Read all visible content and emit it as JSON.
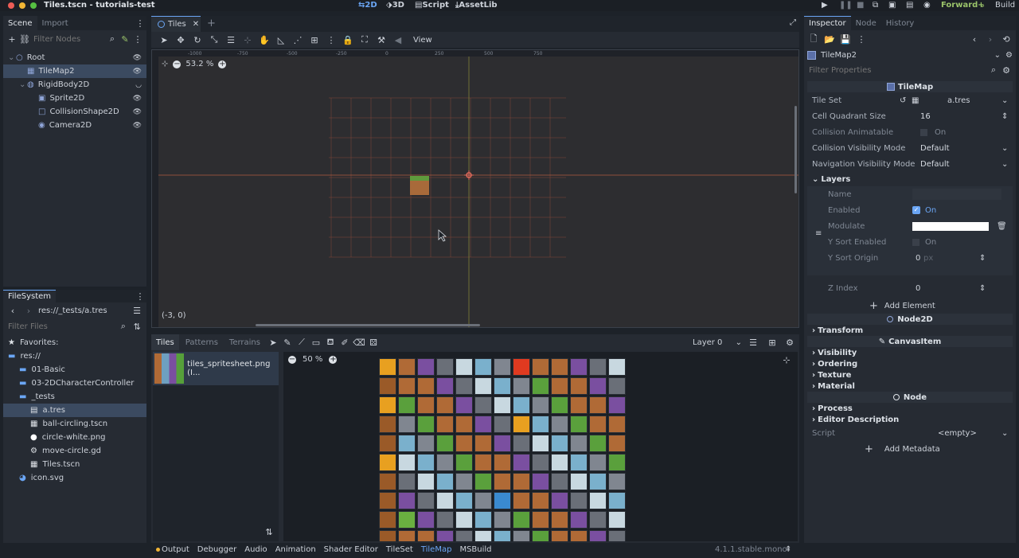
{
  "titlebar": {
    "title": "Tiles.tscn - tutorials-test",
    "modes": [
      "2D",
      "3D",
      "Script",
      "AssetLib"
    ],
    "renderer": "Forward+",
    "build": "Build"
  },
  "scene_dock": {
    "tabs": [
      "Scene",
      "Import"
    ],
    "filter_placeholder": "Filter Nodes",
    "nodes": [
      {
        "label": "Root",
        "depth": 0,
        "icon": "node2d-icon",
        "selected": false
      },
      {
        "label": "TileMap2",
        "depth": 1,
        "icon": "tilemap-icon",
        "selected": true
      },
      {
        "label": "RigidBody2D",
        "depth": 1,
        "icon": "rigidbody-icon",
        "selected": false
      },
      {
        "label": "Sprite2D",
        "depth": 2,
        "icon": "sprite-icon",
        "selected": false
      },
      {
        "label": "CollisionShape2D",
        "depth": 2,
        "icon": "collision-icon",
        "selected": false
      },
      {
        "label": "Camera2D",
        "depth": 2,
        "icon": "camera-icon",
        "selected": false
      }
    ]
  },
  "filesystem": {
    "tab": "FileSystem",
    "path": "res://_tests/a.tres",
    "filter_placeholder": "Filter Files",
    "items": [
      {
        "label": "Favorites:",
        "depth": 0,
        "icon": "star-icon",
        "selected": false
      },
      {
        "label": "res://",
        "depth": 0,
        "icon": "folder-icon",
        "selected": false
      },
      {
        "label": "01-Basic",
        "depth": 1,
        "icon": "folder-icon",
        "selected": false
      },
      {
        "label": "03-2DCharacterController",
        "depth": 1,
        "icon": "folder-icon",
        "selected": false
      },
      {
        "label": "_tests",
        "depth": 1,
        "icon": "folder-icon",
        "selected": false
      },
      {
        "label": "a.tres",
        "depth": 2,
        "icon": "resource-icon",
        "selected": true
      },
      {
        "label": "ball-circling.tscn",
        "depth": 2,
        "icon": "scene-file-icon",
        "selected": false
      },
      {
        "label": "circle-white.png",
        "depth": 2,
        "icon": "image-file-icon",
        "selected": false
      },
      {
        "label": "move-circle.gd",
        "depth": 2,
        "icon": "script-file-icon",
        "selected": false
      },
      {
        "label": "Tiles.tscn",
        "depth": 2,
        "icon": "scene-file-icon",
        "selected": false
      },
      {
        "label": "icon.svg",
        "depth": 1,
        "icon": "svg-file-icon",
        "selected": false
      }
    ]
  },
  "viewport": {
    "tab": "Tiles",
    "view_menu": "View",
    "zoom": "53.2 %",
    "coords": "(-3, 0)",
    "ruler_labels": [
      "-1000",
      "-750",
      "-500",
      "-250",
      "0",
      "250",
      "500",
      "750"
    ]
  },
  "tilemap_panel": {
    "tabs": [
      "Tiles",
      "Patterns",
      "Terrains"
    ],
    "layer": "Layer 0",
    "source": "tiles_spritesheet.png (I...",
    "zoom": "50 %"
  },
  "bottom_bar": {
    "tabs": [
      "Output",
      "Debugger",
      "Audio",
      "Animation",
      "Shader Editor",
      "TileSet",
      "TileMap",
      "MSBuild"
    ],
    "active_tab": "TileMap",
    "version": "4.1.1.stable.mono"
  },
  "inspector": {
    "tabs": [
      "Inspector",
      "Node",
      "History"
    ],
    "object": "TileMap2",
    "filter_placeholder": "Filter Properties",
    "class_header": "TileMap",
    "tile_set": {
      "label": "Tile Set",
      "value": "a.tres"
    },
    "cell_quadrant": {
      "label": "Cell Quadrant Size",
      "value": "16"
    },
    "collision_animatable": {
      "label": "Collision Animatable",
      "value": "On"
    },
    "collision_visibility": {
      "label": "Collision Visibility Mode",
      "value": "Default"
    },
    "navigation_visibility": {
      "label": "Navigation Visibility Mode",
      "value": "Default"
    },
    "layers": {
      "title": "Layers",
      "name_label": "Name",
      "enabled": {
        "label": "Enabled",
        "value": "On"
      },
      "modulate_label": "Modulate",
      "y_sort_enabled": {
        "label": "Y Sort Enabled",
        "value": "On"
      },
      "y_sort_origin": {
        "label": "Y Sort Origin",
        "value": "0",
        "unit": "px"
      },
      "z_index": {
        "label": "Z Index",
        "value": "0"
      },
      "add_element": "Add Element"
    },
    "node2d_header": "Node2D",
    "transform": "Transform",
    "canvasitem_header": "CanvasItem",
    "canvas_groups": [
      "Visibility",
      "Ordering",
      "Texture",
      "Material"
    ],
    "node_header": "Node",
    "node_groups": [
      "Process",
      "Editor Description"
    ],
    "script": {
      "label": "Script",
      "value": "<empty>"
    },
    "add_metadata": "Add Metadata"
  },
  "colors": {
    "accent": "#6ba6f5",
    "background": "#1d2229",
    "panel": "#262b33",
    "grid": "#8a4a3a"
  }
}
